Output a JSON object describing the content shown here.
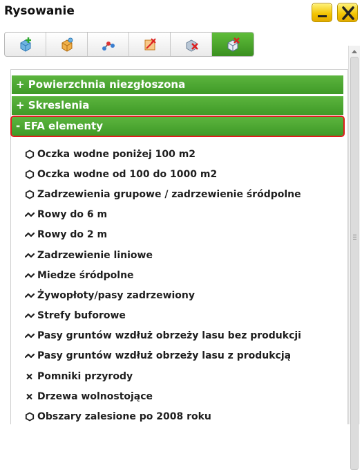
{
  "window": {
    "title": "Rysowanie"
  },
  "toolbar": {
    "tools": [
      {
        "icon": "add-shape-icon",
        "active": false
      },
      {
        "icon": "edit-shape-icon",
        "active": false
      },
      {
        "icon": "edit-vertices-icon",
        "active": false
      },
      {
        "icon": "split-shape-icon",
        "active": false
      },
      {
        "icon": "delete-shape-icon",
        "active": false
      },
      {
        "icon": "remove-shape-icon",
        "active": true
      }
    ],
    "active_color": "#4aa52c"
  },
  "sections": [
    {
      "label": "+ Powierzchnia niezgłoszona"
    },
    {
      "label": "+ Skreslenia"
    },
    {
      "label": "- EFA elementy"
    }
  ],
  "items": [
    {
      "label": "Oczka wodne poniżej 100 m2",
      "icon": "polygon-icon"
    },
    {
      "label": "Oczka wodne od 100 do 1000 m2",
      "icon": "polygon-icon"
    },
    {
      "label": "Zadrzewienia grupowe / zadrzewienie śródpolne",
      "icon": "polygon-icon"
    },
    {
      "label": "Rowy do 6 m",
      "icon": "line-icon"
    },
    {
      "label": "Rowy do 2 m",
      "icon": "line-icon"
    },
    {
      "label": "Zadrzewienie liniowe",
      "icon": "line-icon"
    },
    {
      "label": "Miedze śródpolne",
      "icon": "line-icon"
    },
    {
      "label": "Żywopłoty/pasy zadrzewiony",
      "icon": "line-icon"
    },
    {
      "label": "Strefy buforowe",
      "icon": "line-icon"
    },
    {
      "label": "Pasy gruntów wzdłuż obrzeży lasu bez produkcji",
      "icon": "line-icon"
    },
    {
      "label": "Pasy gruntów wzdłuż obrzeży lasu z produkcją",
      "icon": "line-icon"
    },
    {
      "label": "Pomniki przyrody",
      "icon": "point-icon"
    },
    {
      "label": "Drzewa wolnostojące",
      "icon": "point-icon"
    },
    {
      "label": "Obszary zalesione po 2008 roku",
      "icon": "polygon-icon"
    }
  ],
  "colors": {
    "section_green": "#4aa52c",
    "highlight_red": "#e01c1c",
    "window_button_yellow": "#f2c300"
  }
}
